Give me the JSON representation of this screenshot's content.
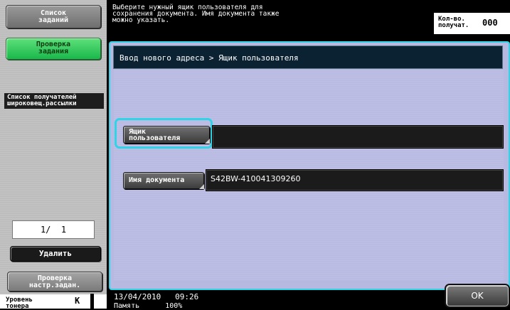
{
  "sidebar": {
    "job_list_label": "Список\nзаданий",
    "check_job_label": "Проверка\nзадания",
    "broadcast_list_label": "Список получателей\nшироковещ.рассылки",
    "page_indicator": "1/  1",
    "delete_label": "Удалить",
    "check_settings_label": "Проверка\nнастр.задан.",
    "toner_label": "Уровень\nтонера",
    "toner_color": "K"
  },
  "header": {
    "message": "Выберите нужный ящик пользователя для\nсохранения документа. Имя документа также\nможно указать.",
    "recipients_label": "Кол-во.\nполучат.",
    "recipients_count": "000"
  },
  "main": {
    "breadcrumb": "Ввод нового адреса > Ящик пользователя",
    "user_box_button": "Ящик\nпользователя",
    "user_box_value": "",
    "doc_name_button": "Имя документа",
    "doc_name_value": "S42BW-410041309260"
  },
  "footer": {
    "datetime": "13/04/2010   09:26",
    "memory": "Память      100%",
    "ok_label": "OK"
  },
  "colors": {
    "accent_cyan": "#2fd4e6",
    "panel_lavender": "#b7b9e1",
    "active_green": "#19b84c"
  }
}
